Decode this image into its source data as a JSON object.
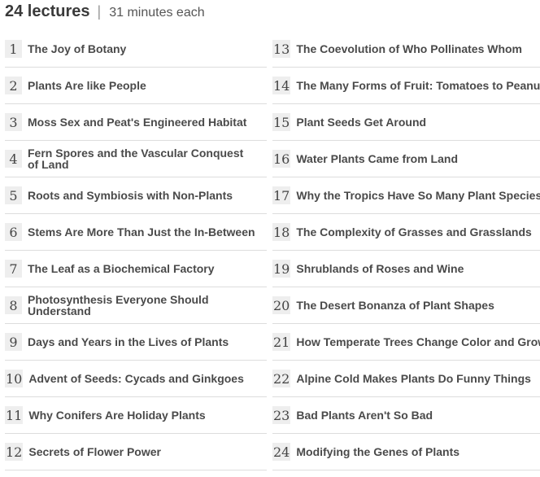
{
  "header": {
    "count_label": "24 lectures",
    "separator": "|",
    "duration_label": "31 minutes each"
  },
  "lectures": [
    {
      "num": "1",
      "title": "The Joy of Botany"
    },
    {
      "num": "2",
      "title": "Plants Are like People"
    },
    {
      "num": "3",
      "title": "Moss Sex and Peat's Engineered Habitat"
    },
    {
      "num": "4",
      "title": "Fern Spores and the Vascular Conquest of Land"
    },
    {
      "num": "5",
      "title": "Roots and Symbiosis with Non-Plants"
    },
    {
      "num": "6",
      "title": "Stems Are More Than Just the In-Between"
    },
    {
      "num": "7",
      "title": "The Leaf as a Biochemical Factory"
    },
    {
      "num": "8",
      "title": "Photosynthesis Everyone Should Understand"
    },
    {
      "num": "9",
      "title": "Days and Years in the Lives of Plants"
    },
    {
      "num": "10",
      "title": "Advent of Seeds: Cycads and Ginkgoes"
    },
    {
      "num": "11",
      "title": "Why Conifers Are Holiday Plants"
    },
    {
      "num": "12",
      "title": "Secrets of Flower Power"
    },
    {
      "num": "13",
      "title": "The Coevolution of Who Pollinates Whom"
    },
    {
      "num": "14",
      "title": "The Many Forms of Fruit: Tomatoes to Peanuts"
    },
    {
      "num": "15",
      "title": "Plant Seeds Get Around"
    },
    {
      "num": "16",
      "title": "Water Plants Came from Land"
    },
    {
      "num": "17",
      "title": "Why the Tropics Have So Many Plant Species"
    },
    {
      "num": "18",
      "title": "The Complexity of Grasses and Grasslands"
    },
    {
      "num": "19",
      "title": "Shrublands of Roses and Wine"
    },
    {
      "num": "20",
      "title": "The Desert Bonanza of Plant Shapes"
    },
    {
      "num": "21",
      "title": "How Temperate Trees Change Color and Grow"
    },
    {
      "num": "22",
      "title": "Alpine Cold Makes Plants Do Funny Things"
    },
    {
      "num": "23",
      "title": "Bad Plants Aren't So Bad"
    },
    {
      "num": "24",
      "title": "Modifying the Genes of Plants"
    }
  ]
}
